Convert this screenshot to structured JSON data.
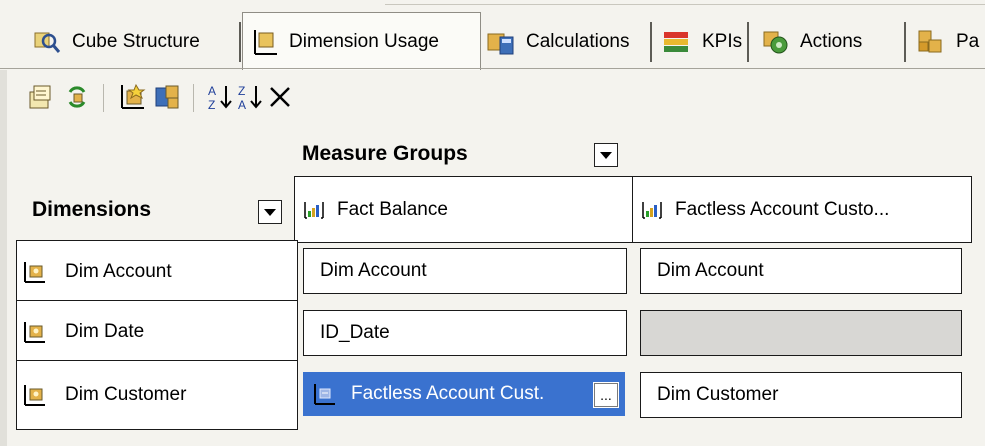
{
  "tabs": [
    {
      "label": "Cube Structure",
      "icon": "cube-structure-icon",
      "active": false
    },
    {
      "label": "Dimension Usage",
      "icon": "dimension-usage-icon",
      "active": true
    },
    {
      "label": "Calculations",
      "icon": "calculator-icon",
      "active": false
    },
    {
      "label": "KPIs",
      "icon": "kpi-icon",
      "active": false
    },
    {
      "label": "Actions",
      "icon": "actions-icon",
      "active": false
    },
    {
      "label": "Pa",
      "icon": "partitions-icon",
      "active": false
    }
  ],
  "toolbar": {
    "buttons": [
      "add-cube-dimension-icon",
      "refresh-icon",
      "add-relationship-icon",
      "show-dimension-icon",
      "sort-ascending-icon",
      "sort-descending-icon",
      "delete-icon"
    ]
  },
  "grid": {
    "measure_groups_header": "Measure Groups",
    "dimensions_header": "Dimensions",
    "measure_groups": [
      "Fact Balance",
      "Factless Account Custo..."
    ],
    "dimensions": [
      "Dim Account",
      "Dim Date",
      "Dim Customer"
    ],
    "rows": [
      [
        "Dim Account",
        "Dim Account"
      ],
      [
        "ID_Date",
        ""
      ],
      [
        "Factless Account Cust.",
        "Dim Customer"
      ]
    ],
    "ellipsis": "..."
  },
  "colors": {
    "selected": "#3a72cf",
    "background": "#f4f3ee",
    "border": "#1a1a1a",
    "gray_cell": "#d8d7d4"
  }
}
